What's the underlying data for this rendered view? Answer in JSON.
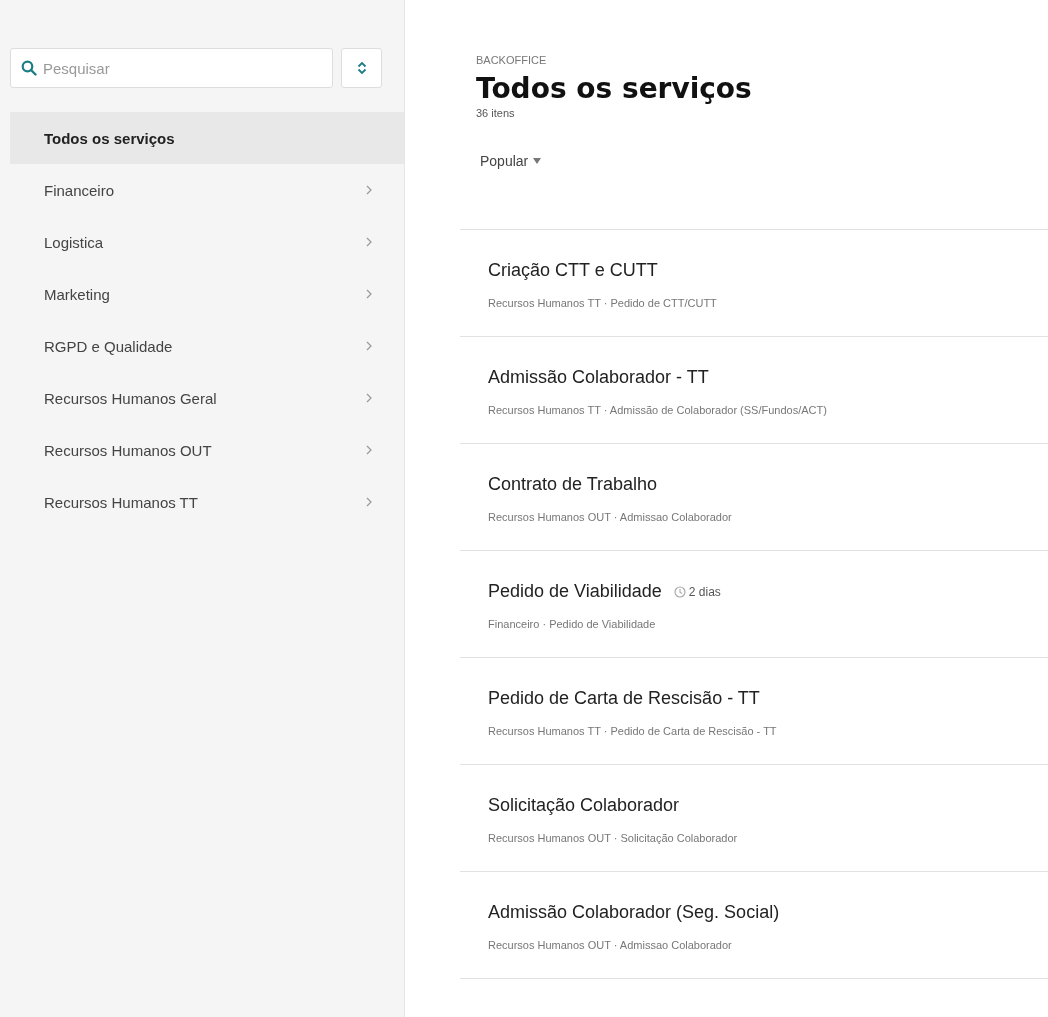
{
  "sidebar": {
    "search": {
      "placeholder": "Pesquisar"
    },
    "items": [
      {
        "label": "Todos os serviços",
        "selected": true,
        "has_arrow": false
      },
      {
        "label": "Financeiro",
        "selected": false,
        "has_arrow": true
      },
      {
        "label": "Logistica",
        "selected": false,
        "has_arrow": true
      },
      {
        "label": "Marketing",
        "selected": false,
        "has_arrow": true
      },
      {
        "label": "RGPD e Qualidade",
        "selected": false,
        "has_arrow": true
      },
      {
        "label": "Recursos Humanos Geral",
        "selected": false,
        "has_arrow": true
      },
      {
        "label": "Recursos Humanos OUT",
        "selected": false,
        "has_arrow": true
      },
      {
        "label": "Recursos Humanos TT",
        "selected": false,
        "has_arrow": true
      }
    ]
  },
  "header": {
    "eyebrow": "BACKOFFICE",
    "title": "Todos os serviços",
    "count": "36 itens"
  },
  "sort": {
    "label": "Popular"
  },
  "services": [
    {
      "title": "Criação CTT e CUTT",
      "subtitle": "Recursos Humanos TT · Pedido de CTT/CUTT"
    },
    {
      "title": "Admissão Colaborador - TT",
      "subtitle": "Recursos Humanos TT · Admissão de Colaborador (SS/Fundos/ACT)"
    },
    {
      "title": "Contrato de Trabalho",
      "subtitle": "Recursos Humanos OUT · Admissao Colaborador"
    },
    {
      "title": "Pedido de Viabilidade",
      "eta": "2 dias",
      "subtitle": "Financeiro · Pedido de Viabilidade"
    },
    {
      "title": "Pedido de Carta de Rescisão - TT",
      "subtitle": "Recursos Humanos TT · Pedido de Carta de Rescisão - TT"
    },
    {
      "title": "Solicitação Colaborador",
      "subtitle": "Recursos Humanos OUT · Solicitação Colaborador"
    },
    {
      "title": "Admissão Colaborador (Seg. Social)",
      "subtitle": "Recursos Humanos OUT · Admissao Colaborador"
    }
  ]
}
